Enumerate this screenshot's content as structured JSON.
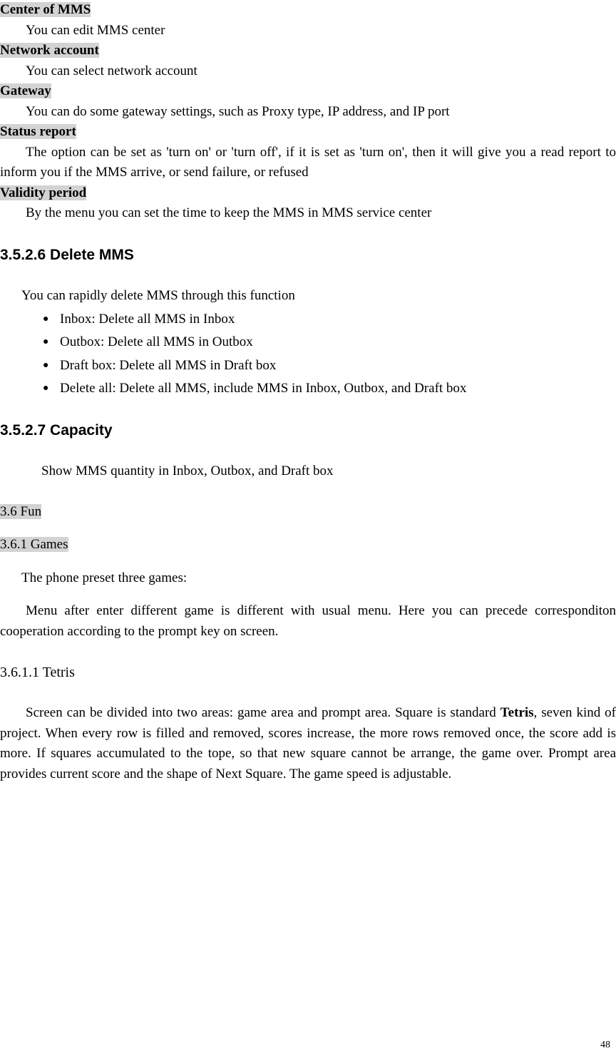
{
  "settings": {
    "centerOfMms": {
      "label": "Center of MMS  ",
      "desc": "You can edit MMS center"
    },
    "networkAccount": {
      "label": "Network account",
      "desc": "You can select network account"
    },
    "gateway": {
      "label": "Gateway",
      "desc": "You can do some gateway settings, such as Proxy type, IP address, and IP port"
    },
    "statusReport": {
      "label": "Status report",
      "desc": "The option can be set as 'turn on' or 'turn off', if it is set as 'turn on', then it will give you a read report to inform you if the MMS arrive, or send failure, or refused"
    },
    "validityPeriod": {
      "label": "Validity period",
      "desc": "By the menu you can set the time to keep the MMS in MMS service center"
    }
  },
  "deleteMms": {
    "heading": "3.5.2.6 Delete MMS",
    "intro": "You can rapidly delete MMS through this function",
    "items": [
      "Inbox: Delete all MMS in Inbox",
      "Outbox: Delete all MMS in Outbox",
      "Draft box: Delete all MMS in Draft box",
      "Delete all: Delete all MMS, include MMS in Inbox, Outbox, and Draft box"
    ]
  },
  "capacity": {
    "heading": "3.5.2.7 Capacity",
    "desc": "Show MMS quantity in Inbox, Outbox, and Draft box"
  },
  "fun": {
    "label": "3.6 Fun  "
  },
  "games": {
    "label": "3.6.1 Games",
    "intro": "The phone preset three games:",
    "para": "Menu after enter different game is different with usual menu. Here you can precede corresponditon cooperation according to the prompt key on screen."
  },
  "tetris": {
    "heading": "3.6.1.1 Tetris",
    "para_start": "Screen can be divided into two areas: game area and prompt area. Square is standard ",
    "bold": "Tetris",
    "para_rest": ", seven kind of project. When every row is filled and removed, scores increase, the more rows removed once, the score add is more. If squares accumulated to the tope, so that new square cannot be arrange, the game over. Prompt area provides current score and the shape of Next Square. The game speed is adjustable."
  },
  "pageNumber": "48"
}
